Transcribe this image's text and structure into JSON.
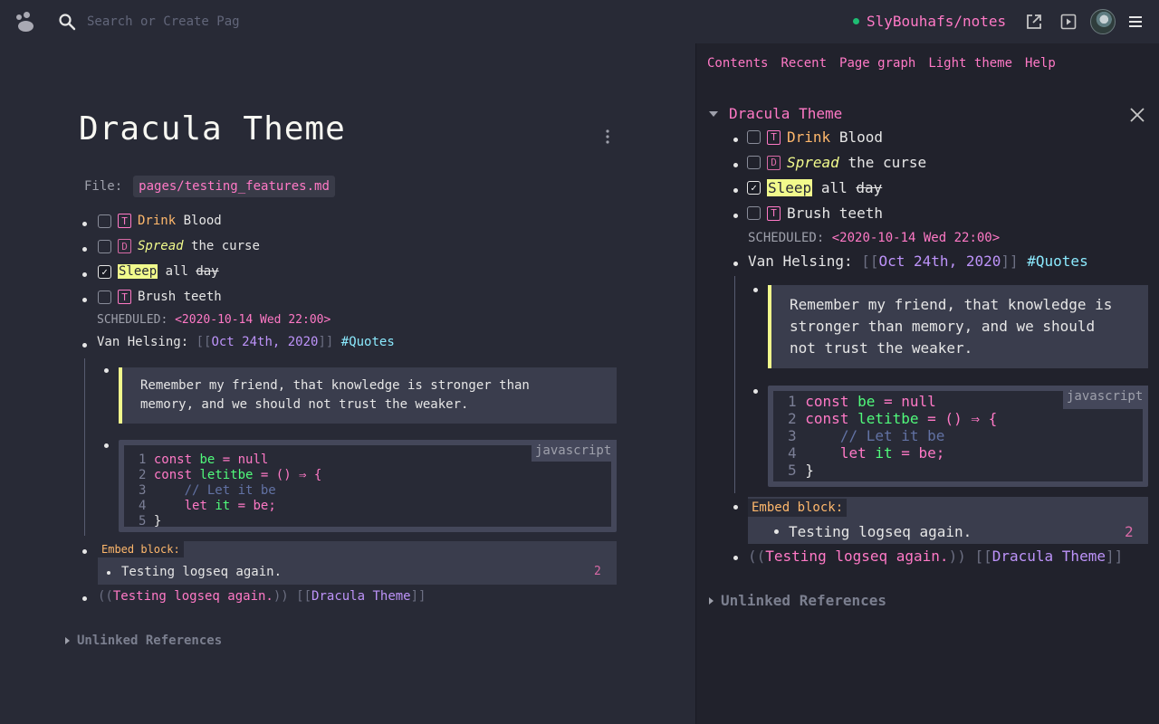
{
  "search": {
    "placeholder": "Search or Create Pag"
  },
  "header": {
    "repo": "SlyBouhafs/notes",
    "repo_status_color": "#1ebd73"
  },
  "main": {
    "title": "Dracula Theme",
    "file_label": "File:",
    "file_path": "pages/testing_features.md",
    "tasks": [
      {
        "priority": "T",
        "first": "Drink",
        "rest": "Blood",
        "checked": false
      },
      {
        "priority": "D",
        "first": "Spread",
        "rest": "the curse",
        "checked": false
      },
      {
        "first": "Sleep",
        "mid": "all",
        "rest": "day",
        "checked": true
      },
      {
        "priority": "T",
        "first": "Brush teeth",
        "checked": false
      }
    ],
    "scheduled_label": "SCHEDULED:",
    "scheduled_value": "<2020-10-14 Wed 22:00>",
    "quote_author": "Van Helsing:",
    "date_link": "Oct 24th, 2020",
    "tag": "#Quotes",
    "quote_lines": [
      "Remember my friend, that knowledge is stronger than",
      "memory, and we should not trust the weaker."
    ],
    "code_lang": "javascript",
    "embed_label": "Embed block:",
    "embed_text": "Testing logseq again.",
    "embed_count": "2",
    "block_ref": "Testing logseq again.",
    "page_ref": "Dracula Theme",
    "unlinked": "Unlinked References"
  },
  "code": {
    "lines": [
      {
        "n": "1",
        "kw": "const",
        "var": "be",
        "rest": " = null"
      },
      {
        "n": "2",
        "kw": "const",
        "var": "letitbe",
        "rest": " = () ⇒ {"
      },
      {
        "n": "3",
        "comment": "// Let it be"
      },
      {
        "n": "4",
        "kw": "let",
        "var": "it",
        "rest": " = be;"
      },
      {
        "n": "5",
        "text": "}"
      }
    ]
  },
  "sidebar": {
    "tabs": [
      "Contents",
      "Recent",
      "Page graph",
      "Light theme",
      "Help"
    ],
    "title": "Dracula Theme",
    "quote_lines": [
      "Remember my friend, that knowledge is",
      "stronger than memory, and we should",
      "not trust the weaker."
    ]
  },
  "colors": {
    "background": "#282a36",
    "sidebar": "#21222c",
    "pink": "#ff79c6",
    "purple": "#bd93f9",
    "yellow": "#f1fa8c",
    "green": "#50fa7b",
    "cyan": "#8be9fd",
    "orange": "#ffb86c"
  }
}
